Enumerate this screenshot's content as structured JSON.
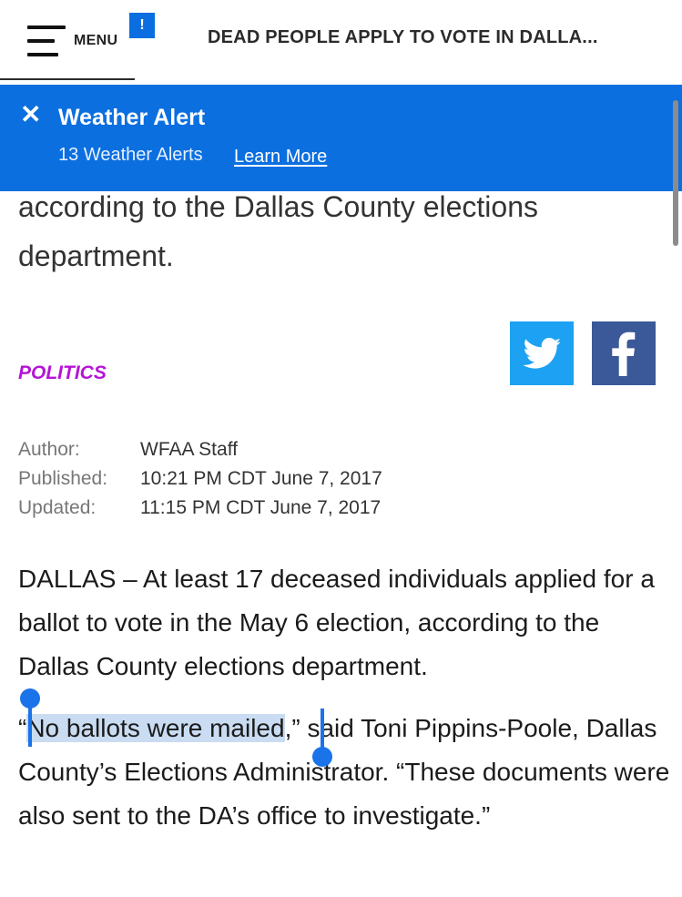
{
  "header": {
    "menu_label": "MENU",
    "alert_badge": "!",
    "headline": "DEAD PEOPLE APPLY TO VOTE IN DALLA..."
  },
  "weather_alert": {
    "close_glyph": "✕",
    "title": "Weather Alert",
    "count_text": "13 Weather Alerts",
    "learn_more": "Learn More",
    "color": "#0b6fe0"
  },
  "article": {
    "fragment": "according to the Dallas County elections department.",
    "section": "POLITICS",
    "section_color": "#b514d6",
    "meta": [
      {
        "label": "Author:",
        "value": "WFAA Staff"
      },
      {
        "label": "Published:",
        "value": "10:21 PM CDT June 7, 2017"
      },
      {
        "label": "Updated:",
        "value": "11:15 PM CDT June 7, 2017"
      }
    ],
    "paragraph1": "DALLAS – At least 17 deceased individuals applied for a ballot to vote in the May 6 election, according to the Dallas County elections department.",
    "paragraph2_open_quote": "“",
    "paragraph2_selected": "No ballots were mailed",
    "paragraph2_rest": ",” said Toni Pippins-Poole, Dallas County’s Elections Administrator. “These documents were also sent to the DA’s office to investigate.”"
  },
  "social": {
    "twitter_icon": "twitter-icon",
    "facebook_icon": "facebook-icon",
    "twitter_color": "#1da1f2",
    "facebook_color": "#3b5998"
  }
}
